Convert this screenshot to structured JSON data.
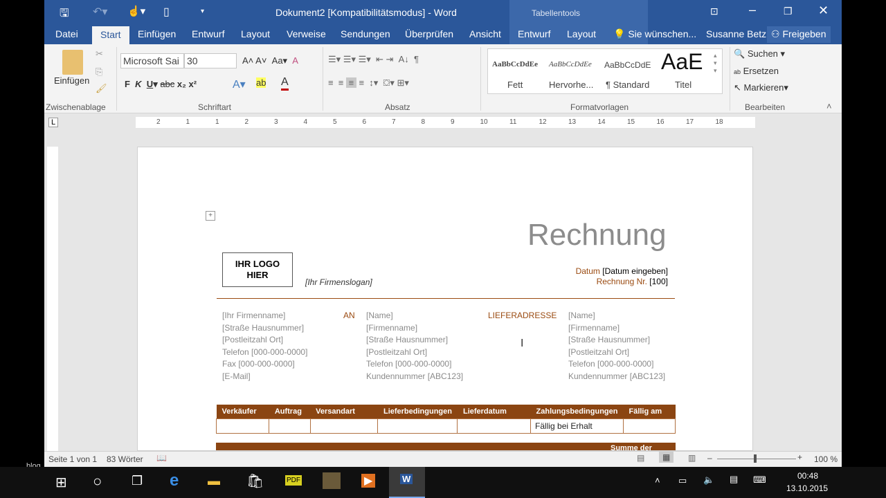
{
  "window": {
    "title": "Dokument2 [Kompatibilitätsmodus] - Word",
    "context_tab": "Tabellentools",
    "user": "Susanne Betz",
    "share": "Freigeben"
  },
  "tabs": [
    "Datei",
    "Start",
    "Einfügen",
    "Entwurf",
    "Layout",
    "Verweise",
    "Sendungen",
    "Überprüfen",
    "Ansicht",
    "Entwurf",
    "Layout",
    "Sie wünschen..."
  ],
  "ribbon": {
    "paste": "Einfügen",
    "font": "Microsoft Sai",
    "size": "30",
    "groups": [
      "Zwischenablage",
      "Schriftart",
      "Absatz",
      "Formatvorlagen",
      "Bearbeiten"
    ],
    "styles": [
      {
        "preview": "AaBbCcDdEe",
        "label": "Fett"
      },
      {
        "preview": "AaBbCcDdEe",
        "label": "Hervorhe..."
      },
      {
        "preview": "AaBbCcDdE",
        "label": "¶ Standard"
      },
      {
        "preview": "AaE",
        "label": "Titel"
      }
    ],
    "edit": [
      "Suchen",
      "Ersetzen",
      "Markieren"
    ]
  },
  "ruler": [
    "2",
    "1",
    "1",
    "2",
    "3",
    "4",
    "5",
    "6",
    "7",
    "8",
    "9",
    "10",
    "11",
    "12",
    "13",
    "14",
    "15",
    "16",
    "17",
    "18"
  ],
  "doc": {
    "heading": "Rechnung",
    "logo": "IHR LOGO HIER",
    "slogan": "[Ihr Firmenslogan]",
    "date_label": "Datum",
    "date_value": "[Datum eingeben]",
    "invoice_label": "Rechnung Nr.",
    "invoice_value": "[100]",
    "sender": [
      "[Ihr Firmenname]",
      "[Straße Hausnummer]",
      "[Postleitzahl Ort]",
      "Telefon [000-000-0000]",
      "Fax [000-000-0000]",
      "[E-Mail]"
    ],
    "to_label": "AN",
    "to": [
      "[Name]",
      "[Firmenname]",
      "[Straße Hausnummer]",
      "[Postleitzahl Ort]",
      "Telefon [000-000-0000]",
      "Kundennummer [ABC123]"
    ],
    "ship_label": "LIEFERADRESSE",
    "ship": [
      "[Name]",
      "[Firmenname]",
      "[Straße Hausnummer]",
      "[Postleitzahl Ort]",
      "Telefon [000-000-0000]",
      "Kundennummer [ABC123]"
    ],
    "table_headers": [
      "Verkäufer",
      "Auftrag",
      "Versandart",
      "Lieferbedingungen",
      "Lieferdatum",
      "Zahlungsbedingungen",
      "Fällig am"
    ],
    "table_row": [
      "",
      "",
      "",
      "",
      "",
      "Fällig bei Erhalt",
      ""
    ],
    "table2_partial": "Summe der"
  },
  "status": {
    "page": "Seite 1 von 1",
    "words": "83 Wörter",
    "zoom": "100 %"
  },
  "taskbar": {
    "time": "00:48",
    "date": "13.10.2015"
  },
  "overlay": "blog"
}
